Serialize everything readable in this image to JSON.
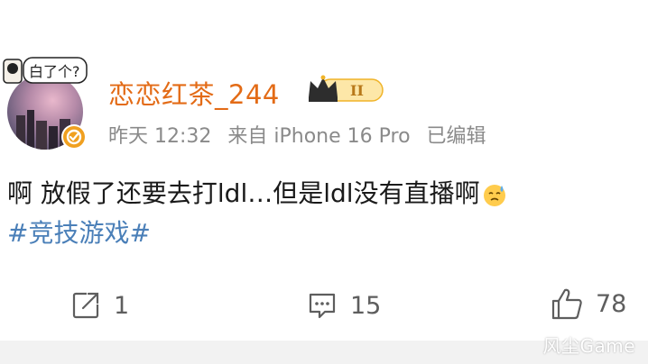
{
  "post": {
    "username": "恋恋红茶_244",
    "badge_text": "II",
    "avatar_sticker_text": "白了个?",
    "meta": {
      "time": "昨天 12:32",
      "source": "来自 iPhone 16 Pro",
      "edited": "已编辑"
    },
    "content": "啊 放假了还要去打ldl…但是ldl没有直播啊",
    "hashtag": "#竞技游戏#"
  },
  "actions": {
    "repost_count": "1",
    "comment_count": "15",
    "like_count": "78"
  },
  "icons": {
    "repost": "share-arrow-icon",
    "comment": "comment-bubble-icon",
    "like": "thumbs-up-icon",
    "verified": "verified-badge-icon",
    "crown": "crown-icon",
    "emoji": "sweat-face-emoji"
  },
  "colors": {
    "username": "#e36b16",
    "hashtag": "#4a7fb8",
    "meta": "#8a8a8a",
    "badge_gold": "#f0b429"
  },
  "watermark": "风尘Game"
}
